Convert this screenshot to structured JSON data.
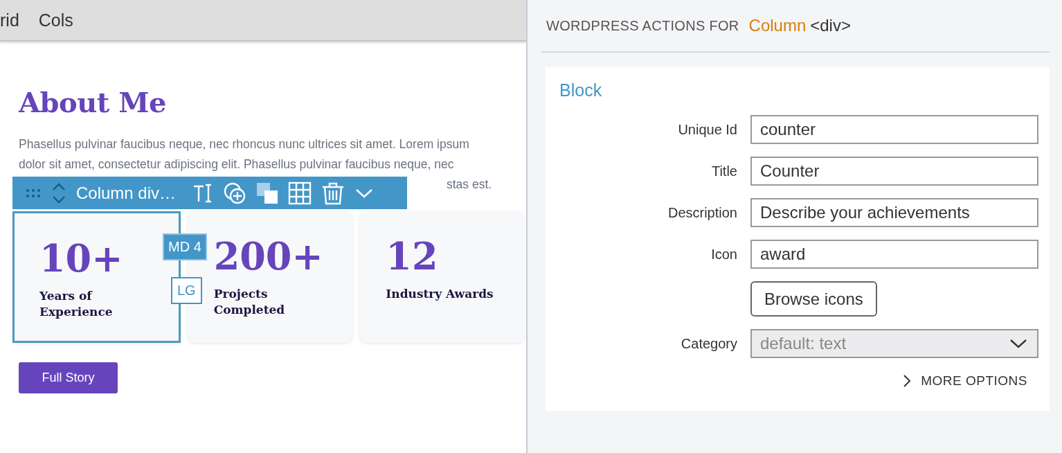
{
  "top_bar": {
    "items": [
      {
        "label": "rid"
      },
      {
        "label": "Cols"
      }
    ]
  },
  "page": {
    "heading": "About Me",
    "paragraph_lines": [
      "Phasellus pulvinar faucibus neque, nec rhoncus nunc ultrices sit amet. Lorem ipsum",
      "dolor sit amet, consectetur adipiscing elit. Phasellus pulvinar faucibus neque, nec"
    ],
    "paragraph_tail": "stas est.",
    "block_toolbar": {
      "label": "Column div…",
      "md_badge": "MD 4",
      "lg_badge": "LG"
    },
    "counters": [
      {
        "value": "10+",
        "caption": "Years of Experience",
        "selected": true
      },
      {
        "value": "200+",
        "caption": "Projects Completed",
        "selected": false
      },
      {
        "value": "12",
        "caption": "Industry Awards",
        "selected": false
      }
    ],
    "button": "Full Story"
  },
  "panel": {
    "title_prefix": "WORDPRESS ACTIONS FOR",
    "element_name": "Column",
    "element_tag": "<div>",
    "section": "Block",
    "fields": [
      {
        "kind": "text",
        "label": "Unique Id",
        "value": "counter"
      },
      {
        "kind": "text",
        "label": "Title",
        "value": "Counter"
      },
      {
        "kind": "text",
        "label": "Description",
        "value": "Describe your achievements"
      },
      {
        "kind": "text",
        "label": "Icon",
        "value": "award"
      },
      {
        "kind": "button",
        "label": "Browse icons"
      },
      {
        "kind": "select",
        "label": "Category",
        "value": "default: text",
        "disabled": true
      }
    ],
    "more_options": "MORE OPTIONS"
  }
}
